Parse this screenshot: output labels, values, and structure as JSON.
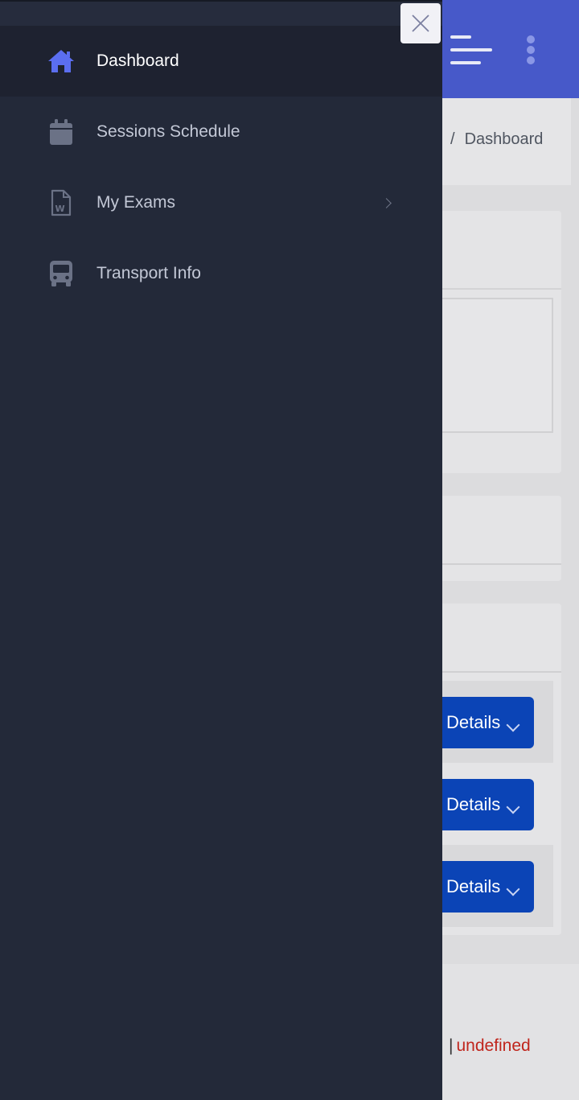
{
  "sidebar": {
    "items": [
      {
        "label": "Dashboard",
        "icon": "home-icon",
        "active": true
      },
      {
        "label": "Sessions Schedule",
        "icon": "calendar-icon",
        "active": false
      },
      {
        "label": "My Exams",
        "icon": "word-document-icon",
        "active": false,
        "has_submenu": true
      },
      {
        "label": "Transport Info",
        "icon": "bus-icon",
        "active": false
      }
    ]
  },
  "close_button": {
    "icon": "close-icon"
  },
  "header": {
    "menu_icon": "hamburger-icon",
    "more_icon": "more-vertical-icon"
  },
  "breadcrumb": {
    "separator": "/",
    "current": "Dashboard"
  },
  "details_buttons": [
    {
      "label": "Details"
    },
    {
      "label": "Details"
    },
    {
      "label": "Details"
    }
  ],
  "footer": {
    "separator": "|",
    "value": "undefined"
  },
  "colors": {
    "sidebar_bg": "#232939",
    "accent": "#4759c9",
    "active_icon": "#5b6ef0",
    "button": "#0b44b6",
    "error_text": "#c0261d"
  }
}
